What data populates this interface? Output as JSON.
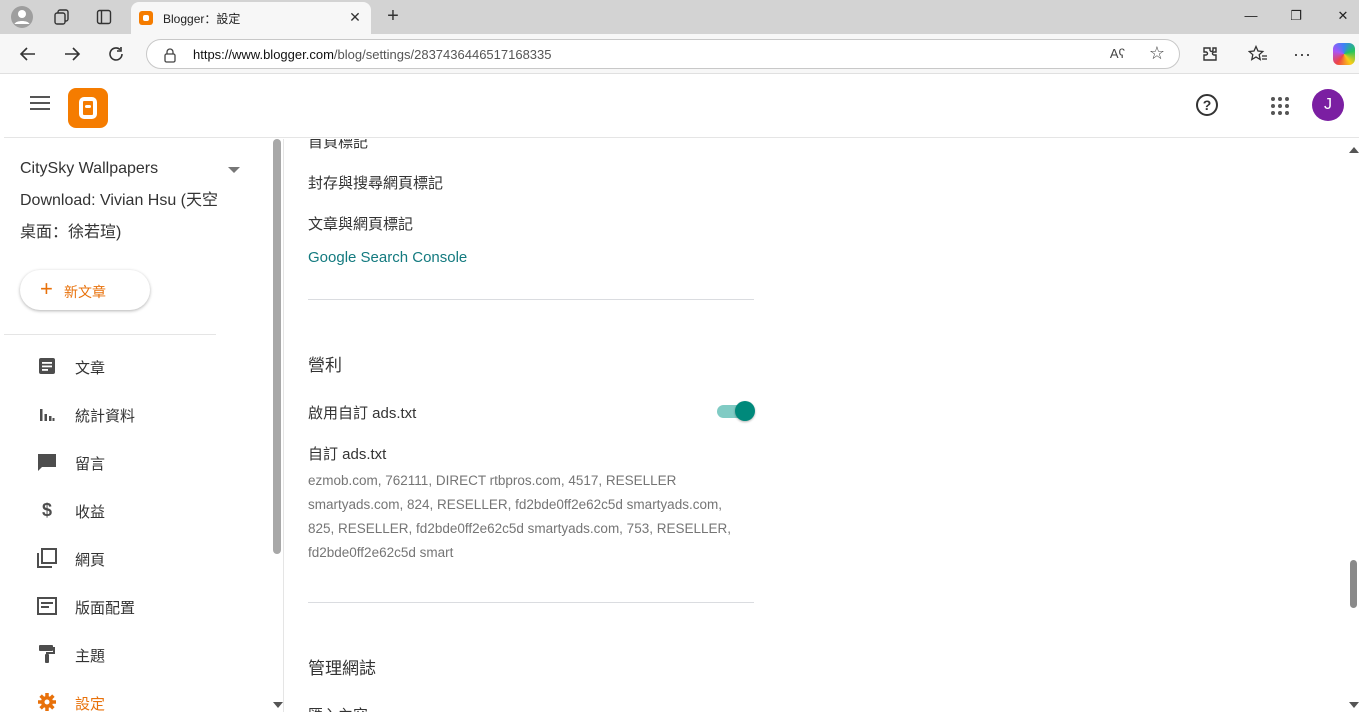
{
  "browser": {
    "tab_title": "Blogger：設定",
    "url_host": "https://www.blogger.com",
    "url_path": "/blog/settings/2837436446517168335",
    "read_aloud_label": "Aʕ",
    "icons": [
      "profile-icon",
      "workspaces-icon",
      "tab-actions-icon",
      "back-icon",
      "forward-icon",
      "refresh-icon",
      "lock-icon",
      "star-icon",
      "extensions-icon",
      "favorites-icon",
      "more-icon",
      "copilot-icon"
    ]
  },
  "header": {
    "help_label": "?",
    "avatar_letter": "J"
  },
  "sidebar": {
    "blog_title": "CitySky Wallpapers Download: Vivian Hsu (天空桌面：徐若瑄)",
    "new_post": "新文章",
    "items": [
      {
        "label": "文章",
        "icon": "posts-icon"
      },
      {
        "label": "統計資料",
        "icon": "stats-icon"
      },
      {
        "label": "留言",
        "icon": "comments-icon"
      },
      {
        "label": "收益",
        "icon": "earnings-icon"
      },
      {
        "label": "網頁",
        "icon": "pages-icon"
      },
      {
        "label": "版面配置",
        "icon": "layout-icon"
      },
      {
        "label": "主題",
        "icon": "theme-icon"
      },
      {
        "label": "設定",
        "icon": "settings-icon"
      }
    ]
  },
  "main": {
    "partial_top": "首頁標記",
    "archive_tags": "封存與搜尋網頁標記",
    "post_tags": "文章與網頁標記",
    "search_console": "Google Search Console",
    "monetization_title": "營利",
    "enable_ads_label": "啟用自訂 ads.txt",
    "enable_ads_on": true,
    "custom_ads_label": "自訂 ads.txt",
    "ads_text": "ezmob.com, 762111, DIRECT rtbpros.com, 4517, RESELLER smartyads.com, 824, RESELLER, fd2bde0ff2e62c5d smartyads.com, 825, RESELLER, fd2bde0ff2e62c5d smartyads.com, 753, RESELLER, fd2bde0ff2e62c5d smart",
    "manage_title": "管理網誌",
    "partial_bottom": "匯入內容"
  },
  "colors": {
    "accent": "#e8710a",
    "brand": "#f57c00",
    "link": "#137a7f",
    "toggle": "#00897b",
    "avatar": "#7b1fa2"
  }
}
